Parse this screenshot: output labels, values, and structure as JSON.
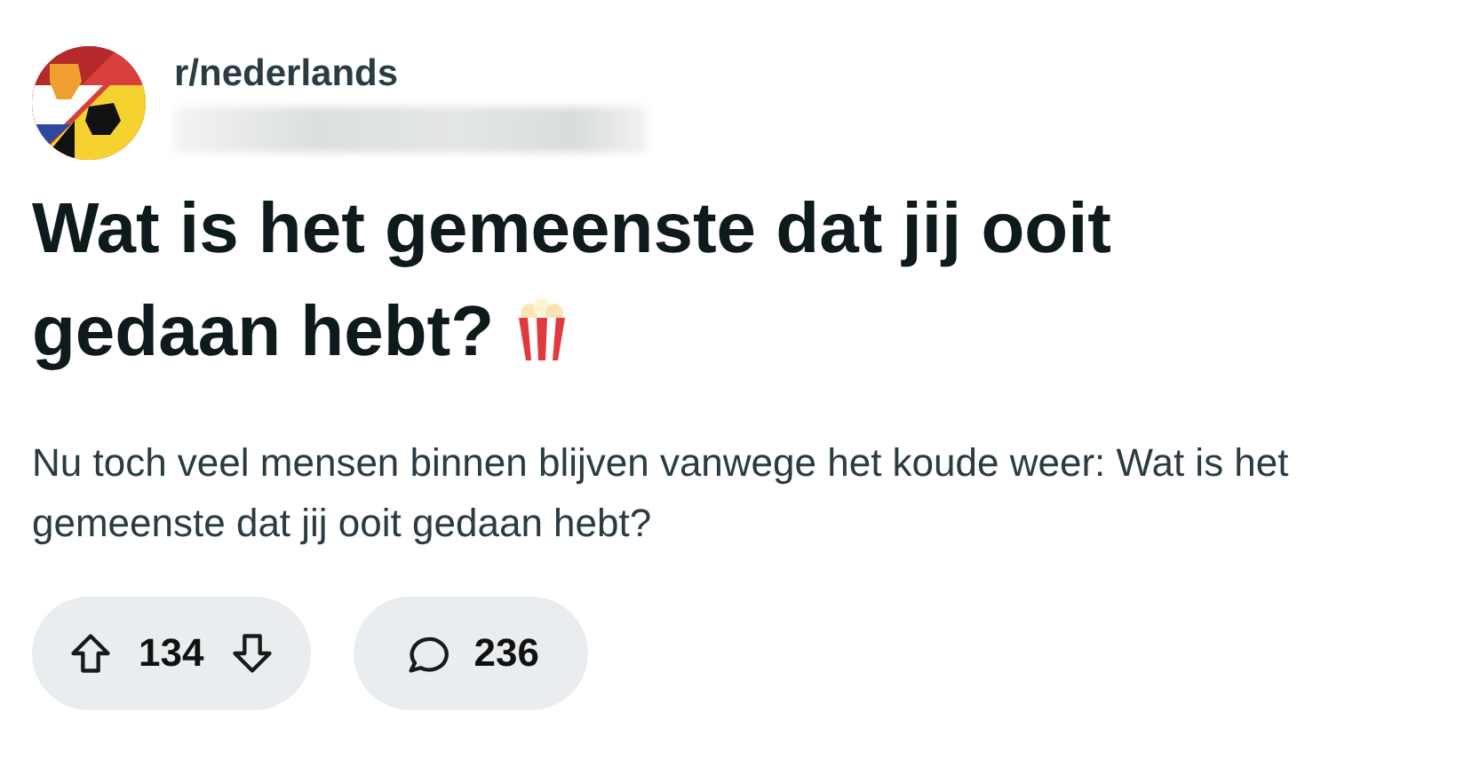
{
  "subreddit": "r/nederlands",
  "post": {
    "title": "Wat is het gemeenste dat jij ooit gedaan hebt?",
    "body": "Nu toch veel mensen binnen blijven vanwege het koude weer: Wat is het gemeenste dat jij ooit gedaan hebt?"
  },
  "actions": {
    "votes": "134",
    "comments": "236"
  }
}
